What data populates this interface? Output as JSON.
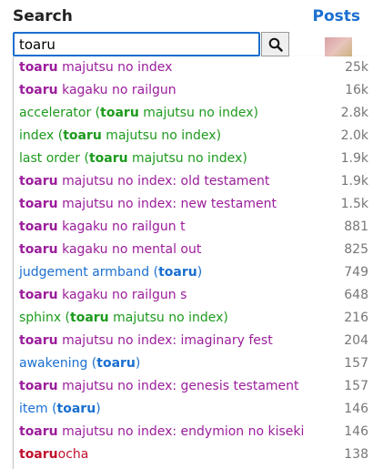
{
  "header": {
    "search_title": "Search",
    "posts_title": "Posts"
  },
  "search": {
    "value": "toaru",
    "button_icon": "search-icon"
  },
  "colors": {
    "copyright": "#9b1d9b",
    "character": "#1d9a1d",
    "general": "#1a6fd0",
    "meta": "#c0102c",
    "accent": "#1a6fd0"
  },
  "suggestions": [
    {
      "match": "toaru",
      "before": "",
      "after": " majutsu no index",
      "count": "25k",
      "category": "copyright"
    },
    {
      "match": "toaru",
      "before": "",
      "after": " kagaku no railgun",
      "count": "16k",
      "category": "copyright"
    },
    {
      "match": "toaru",
      "before": "accelerator (",
      "after": " majutsu no index)",
      "count": "2.8k",
      "category": "character"
    },
    {
      "match": "toaru",
      "before": "index (",
      "after": " majutsu no index)",
      "count": "2.0k",
      "category": "character"
    },
    {
      "match": "toaru",
      "before": "last order (",
      "after": " majutsu no index)",
      "count": "1.9k",
      "category": "character"
    },
    {
      "match": "toaru",
      "before": "",
      "after": " majutsu no index: old testament",
      "count": "1.9k",
      "category": "copyright"
    },
    {
      "match": "toaru",
      "before": "",
      "after": " majutsu no index: new testament",
      "count": "1.5k",
      "category": "copyright"
    },
    {
      "match": "toaru",
      "before": "",
      "after": " kagaku no railgun t",
      "count": "881",
      "category": "copyright"
    },
    {
      "match": "toaru",
      "before": "",
      "after": " kagaku no mental out",
      "count": "825",
      "category": "copyright"
    },
    {
      "match": "toaru",
      "before": "judgement armband (",
      "after": ")",
      "count": "749",
      "category": "general"
    },
    {
      "match": "toaru",
      "before": "",
      "after": " kagaku no railgun s",
      "count": "648",
      "category": "copyright"
    },
    {
      "match": "toaru",
      "before": "sphinx (",
      "after": " majutsu no index)",
      "count": "216",
      "category": "character"
    },
    {
      "match": "toaru",
      "before": "",
      "after": " majutsu no index: imaginary fest",
      "count": "204",
      "category": "copyright"
    },
    {
      "match": "toaru",
      "before": "awakening (",
      "after": ")",
      "count": "157",
      "category": "general"
    },
    {
      "match": "toaru",
      "before": "",
      "after": " majutsu no index: genesis testament",
      "count": "157",
      "category": "copyright"
    },
    {
      "match": "toaru",
      "before": "item (",
      "after": ")",
      "count": "146",
      "category": "general"
    },
    {
      "match": "toaru",
      "before": "",
      "after": " majutsu no index: endymion no kiseki",
      "count": "146",
      "category": "copyright"
    },
    {
      "match": "toaru",
      "before": "",
      "after": "ocha",
      "count": "138",
      "category": "meta"
    }
  ]
}
